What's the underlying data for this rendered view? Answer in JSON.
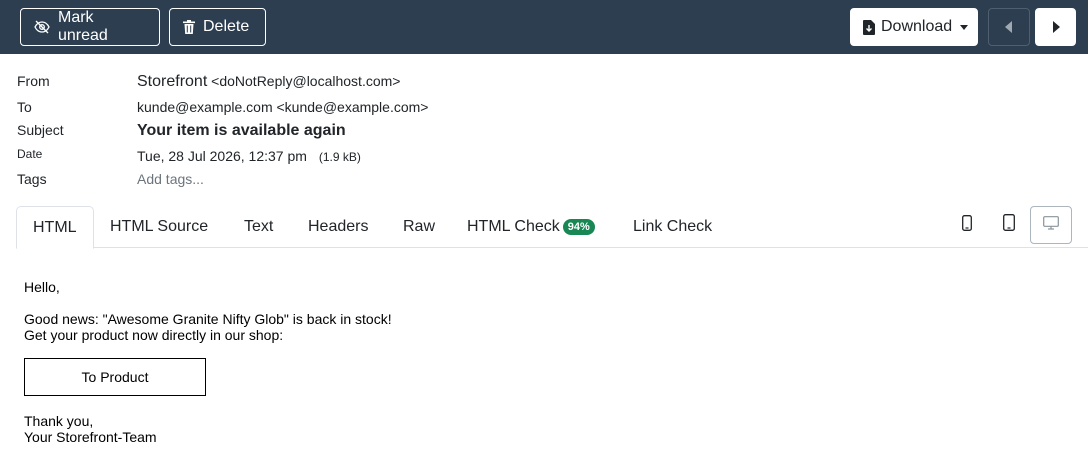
{
  "toolbar": {
    "mark_unread": "Mark unread",
    "delete": "Delete",
    "download": "Download",
    "icons": {
      "mark_unread": "eye-slash-icon",
      "delete": "trash-icon",
      "download": "file-download-icon",
      "prev": "caret-left-icon",
      "next": "caret-right-icon"
    }
  },
  "header": {
    "from_label": "From",
    "from_name": "Storefront",
    "from_email": "<doNotReply@localhost.com>",
    "to_label": "To",
    "to_value": "kunde@example.com <kunde@example.com>",
    "subject_label": "Subject",
    "subject_value": "Your item is available again",
    "date_label": "Date",
    "date_value": "Tue, 28 Jul 2026, 12:37 pm",
    "size": "(1.9 kB)",
    "tags_label": "Tags",
    "tags_placeholder": "Add tags..."
  },
  "tabs": [
    {
      "label": "HTML"
    },
    {
      "label": "HTML Source"
    },
    {
      "label": "Text"
    },
    {
      "label": "Headers"
    },
    {
      "label": "Raw"
    },
    {
      "label": "HTML Check",
      "badge": "94%"
    },
    {
      "label": "Link Check"
    }
  ],
  "device_icons": [
    "phone-icon",
    "tablet-icon",
    "desktop-icon"
  ],
  "colors": {
    "topbar": "#2c3e50",
    "badge": "#198754"
  },
  "body": {
    "greeting": "Hello,",
    "line1": "Good news: \"Awesome Granite Nifty Glob\" is back in stock!",
    "line2": "Get your product now directly in our shop:",
    "button": "To Product",
    "thanks": "Thank you,",
    "signature": "Your Storefront-Team"
  }
}
